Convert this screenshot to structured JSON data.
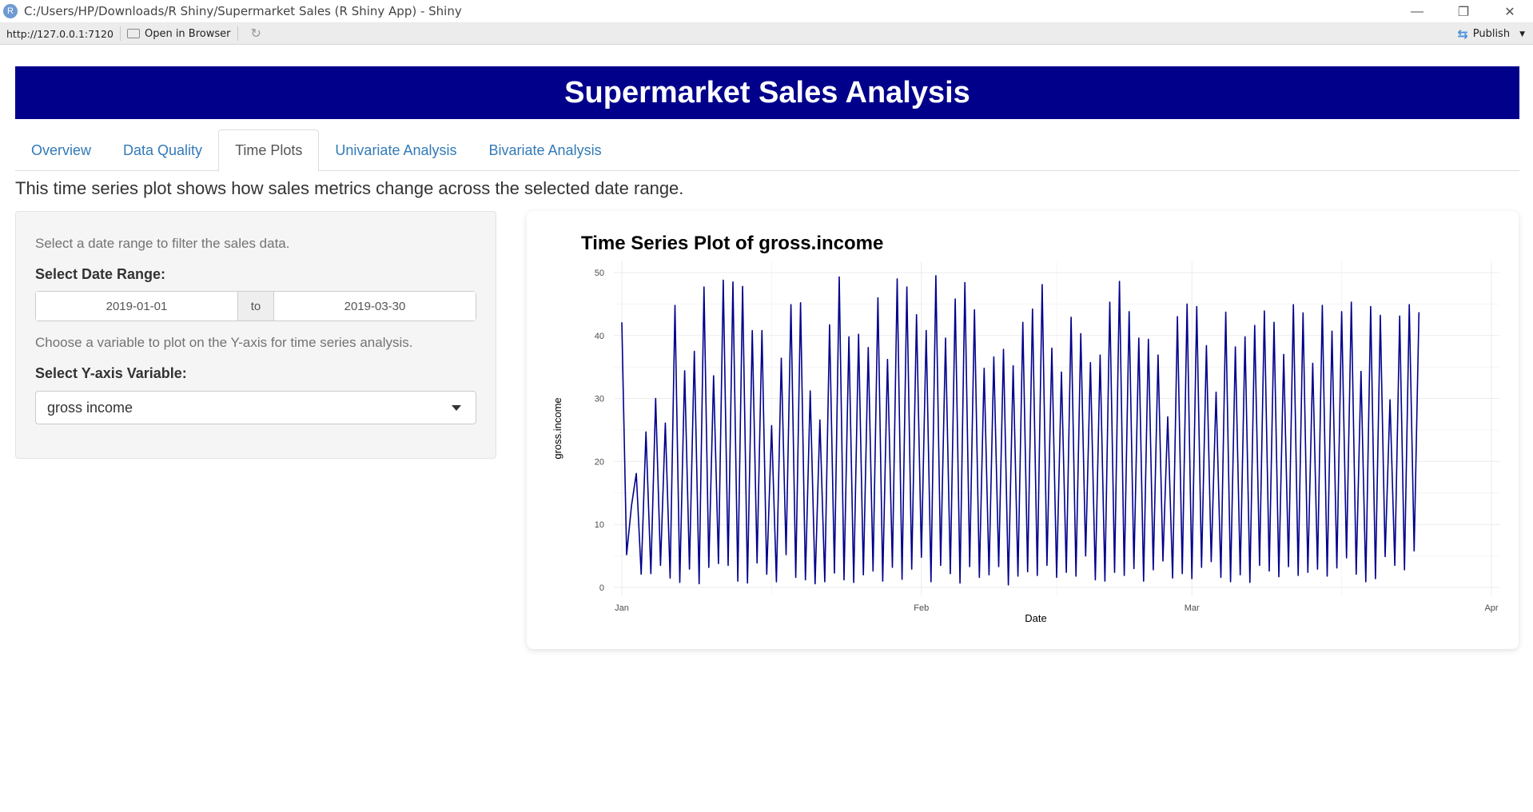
{
  "window": {
    "title": "C:/Users/HP/Downloads/R Shiny/Supermarket Sales (R Shiny App) - Shiny",
    "url": "http://127.0.0.1:7120",
    "open_in_browser": "Open in Browser",
    "publish": "Publish"
  },
  "app": {
    "title": "Supermarket Sales Analysis",
    "tabs": [
      {
        "label": "Overview"
      },
      {
        "label": "Data Quality"
      },
      {
        "label": "Time Plots",
        "active": true
      },
      {
        "label": "Univariate Analysis"
      },
      {
        "label": "Bivariate Analysis"
      }
    ],
    "description": "This time series plot shows how sales metrics change across the selected date range.",
    "sidebar": {
      "date_help": "Select a date range to filter the sales data.",
      "date_label": "Select Date Range:",
      "date_start": "2019-01-01",
      "date_sep": "to",
      "date_end": "2019-03-30",
      "var_help": "Choose a variable to plot on the Y-axis for time series analysis.",
      "var_label": "Select Y-axis Variable:",
      "var_selected": "gross income"
    }
  },
  "chart_data": {
    "type": "line",
    "title": "Time Series Plot of gross.income",
    "xlabel": "Date",
    "ylabel": "gross.income",
    "xlim": [
      "2019-01-01",
      "2019-04-01"
    ],
    "ylim": [
      0,
      50
    ],
    "x_ticks": [
      "Jan",
      "Feb",
      "Mar",
      "Apr"
    ],
    "y_ticks": [
      0,
      10,
      20,
      30,
      40,
      50
    ],
    "grid": true,
    "color": "#00008B",
    "x": [
      "2019-01-01",
      "2019-01-01",
      "2019-01-02",
      "2019-01-02",
      "2019-01-03",
      "2019-01-03",
      "2019-01-04",
      "2019-01-04",
      "2019-01-05",
      "2019-01-05",
      "2019-01-06",
      "2019-01-06",
      "2019-01-07",
      "2019-01-07",
      "2019-01-08",
      "2019-01-08",
      "2019-01-09",
      "2019-01-09",
      "2019-01-10",
      "2019-01-10",
      "2019-01-11",
      "2019-01-11",
      "2019-01-12",
      "2019-01-12",
      "2019-01-13",
      "2019-01-13",
      "2019-01-14",
      "2019-01-14",
      "2019-01-15",
      "2019-01-15",
      "2019-01-16",
      "2019-01-16",
      "2019-01-17",
      "2019-01-17",
      "2019-01-18",
      "2019-01-18",
      "2019-01-19",
      "2019-01-19",
      "2019-01-20",
      "2019-01-20",
      "2019-01-21",
      "2019-01-21",
      "2019-01-22",
      "2019-01-22",
      "2019-01-23",
      "2019-01-23",
      "2019-01-24",
      "2019-01-24",
      "2019-01-25",
      "2019-01-25",
      "2019-01-26",
      "2019-01-26",
      "2019-01-27",
      "2019-01-27",
      "2019-01-28",
      "2019-01-28",
      "2019-01-29",
      "2019-01-29",
      "2019-01-30",
      "2019-01-30",
      "2019-01-31",
      "2019-01-31",
      "2019-02-01",
      "2019-02-01",
      "2019-02-02",
      "2019-02-02",
      "2019-02-03",
      "2019-02-03",
      "2019-02-04",
      "2019-02-04",
      "2019-02-05",
      "2019-02-05",
      "2019-02-06",
      "2019-02-06",
      "2019-02-07",
      "2019-02-07",
      "2019-02-08",
      "2019-02-08",
      "2019-02-09",
      "2019-02-09",
      "2019-02-10",
      "2019-02-10",
      "2019-02-11",
      "2019-02-11",
      "2019-02-12",
      "2019-02-12",
      "2019-02-13",
      "2019-02-13",
      "2019-02-14",
      "2019-02-14",
      "2019-02-15",
      "2019-02-15",
      "2019-02-16",
      "2019-02-16",
      "2019-02-17",
      "2019-02-17",
      "2019-02-18",
      "2019-02-18",
      "2019-02-19",
      "2019-02-19",
      "2019-02-20",
      "2019-02-20",
      "2019-02-21",
      "2019-02-21",
      "2019-02-22",
      "2019-02-22",
      "2019-02-23",
      "2019-02-23",
      "2019-02-24",
      "2019-02-24",
      "2019-02-25",
      "2019-02-25",
      "2019-02-26",
      "2019-02-26",
      "2019-02-27",
      "2019-02-27",
      "2019-02-28",
      "2019-02-28",
      "2019-03-01",
      "2019-03-01",
      "2019-03-02",
      "2019-03-02",
      "2019-03-03",
      "2019-03-03",
      "2019-03-04",
      "2019-03-04",
      "2019-03-05",
      "2019-03-05",
      "2019-03-06",
      "2019-03-06",
      "2019-03-07",
      "2019-03-07",
      "2019-03-08",
      "2019-03-08",
      "2019-03-09",
      "2019-03-09",
      "2019-03-10",
      "2019-03-10",
      "2019-03-11",
      "2019-03-11",
      "2019-03-12",
      "2019-03-12",
      "2019-03-13",
      "2019-03-13",
      "2019-03-14",
      "2019-03-14",
      "2019-03-15",
      "2019-03-15",
      "2019-03-16",
      "2019-03-16",
      "2019-03-17",
      "2019-03-17",
      "2019-03-18",
      "2019-03-18",
      "2019-03-19",
      "2019-03-19",
      "2019-03-20",
      "2019-03-20",
      "2019-03-21",
      "2019-03-21",
      "2019-03-22",
      "2019-03-22",
      "2019-03-23",
      "2019-03-23",
      "2019-03-24",
      "2019-03-24",
      "2019-03-25",
      "2019-03-25",
      "2019-03-26",
      "2019-03-26",
      "2019-03-27",
      "2019-03-27",
      "2019-03-28",
      "2019-03-28",
      "2019-03-29",
      "2019-03-29",
      "2019-03-30",
      "2019-03-30"
    ],
    "y": [
      42.1,
      5.2,
      13.0,
      18.1,
      2.1,
      24.7,
      2.2,
      30.0,
      3.5,
      26.1,
      1.5,
      44.8,
      0.8,
      34.4,
      2.9,
      37.5,
      0.6,
      47.7,
      3.2,
      33.6,
      3.8,
      48.8,
      3.5,
      48.5,
      1.0,
      47.8,
      0.7,
      40.8,
      3.9,
      40.8,
      2.1,
      25.7,
      0.9,
      36.4,
      5.2,
      44.9,
      1.6,
      45.2,
      1.2,
      31.2,
      0.6,
      26.6,
      0.9,
      41.7,
      2.3,
      49.3,
      1.2,
      39.8,
      0.8,
      40.2,
      2.0,
      38.1,
      2.6,
      46.0,
      1.0,
      36.2,
      3.2,
      49.0,
      1.3,
      47.7,
      2.9,
      43.3,
      4.8,
      40.8,
      0.9,
      49.5,
      3.5,
      39.6,
      2.2,
      45.8,
      0.7,
      48.4,
      3.3,
      44.1,
      1.6,
      34.8,
      2.0,
      36.6,
      3.3,
      37.8,
      0.4,
      35.2,
      1.8,
      42.1,
      2.5,
      44.2,
      1.9,
      48.1,
      3.5,
      38.0,
      1.6,
      34.2,
      2.4,
      42.9,
      1.8,
      40.3,
      5.0,
      35.7,
      1.2,
      36.9,
      1.0,
      45.3,
      2.4,
      48.6,
      1.9,
      43.8,
      3.0,
      39.6,
      1.0,
      39.4,
      2.8,
      36.9,
      4.2,
      27.1,
      1.5,
      43.0,
      2.2,
      45.0,
      1.4,
      44.6,
      3.2,
      38.4,
      4.1,
      31.0,
      1.6,
      43.7,
      0.9,
      38.2,
      2.0,
      39.8,
      0.8,
      41.6,
      3.5,
      43.9,
      2.6,
      42.1,
      1.7,
      37.0,
      3.3,
      44.9,
      1.9,
      43.6,
      2.4,
      35.6,
      2.9,
      44.8,
      1.8,
      40.7,
      3.1,
      43.8,
      4.7,
      45.3,
      2.1,
      34.3,
      0.9,
      44.6,
      1.4,
      43.2,
      4.9,
      29.8,
      3.5,
      43.1,
      2.8,
      44.9,
      5.8,
      43.7
    ]
  }
}
